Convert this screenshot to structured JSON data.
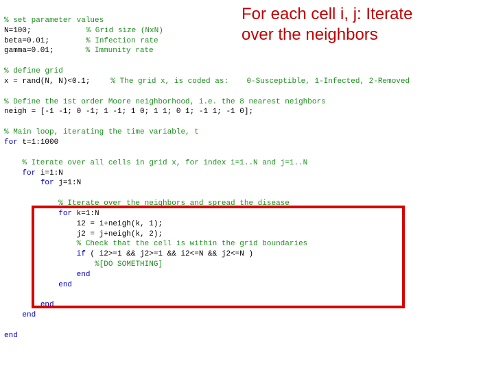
{
  "callout": {
    "line1": "For each cell i, j: Iterate",
    "line2": "over the neighbors"
  },
  "code": {
    "l01_c": "% set parameter values",
    "l02_a": "N=100;",
    "l02_c": "% Grid size (NxN)",
    "l03_a": "beta=0.01;",
    "l03_c": "% Infection rate",
    "l04_a": "gamma=0.01;",
    "l04_c": "% Immunity rate",
    "l05_c": "% define grid",
    "l06_a": "x = rand(N, N)<0.1;",
    "l06_c": "% The grid x, is coded as:    0-Susceptible, 1-Infected, 2-Removed",
    "l07_c": "% Define the 1st order Moore neighborhood, i.e. the 8 nearest neighbors",
    "l08_a": "neigh = [-1 -1; 0 -1; 1 -1; 1 0; 1 1; 0 1; -1 1; -1 0];",
    "l09_c": "% Main loop, iterating the time variable, t",
    "l10_k": "for",
    "l10_a": " t=1:1000",
    "l11_c": "% Iterate over all cells in grid x, for index i=1..N and j=1..N",
    "l12_k": "for",
    "l12_a": " i=1:N",
    "l13_k": "for",
    "l13_a": " j=1:N",
    "l14_c": "% Iterate over the neighbors and spread the disease",
    "l15_k": "for",
    "l15_a": " k=1:N",
    "l16_a": "i2 = i+neigh(k, 1);",
    "l17_a": "j2 = j+neigh(k, 2);",
    "l18_c": "% Check that the cell is within the grid boundaries",
    "l19_k": "if",
    "l19_a": " ( i2>=1 && j2>=1 && i2<=N && j2<=N )",
    "l20_c": "%[DO SOMETHING]",
    "l21_k": "end",
    "l22_k": "end",
    "l23_k": "end",
    "l24_k": "end",
    "l25_k": "end"
  }
}
